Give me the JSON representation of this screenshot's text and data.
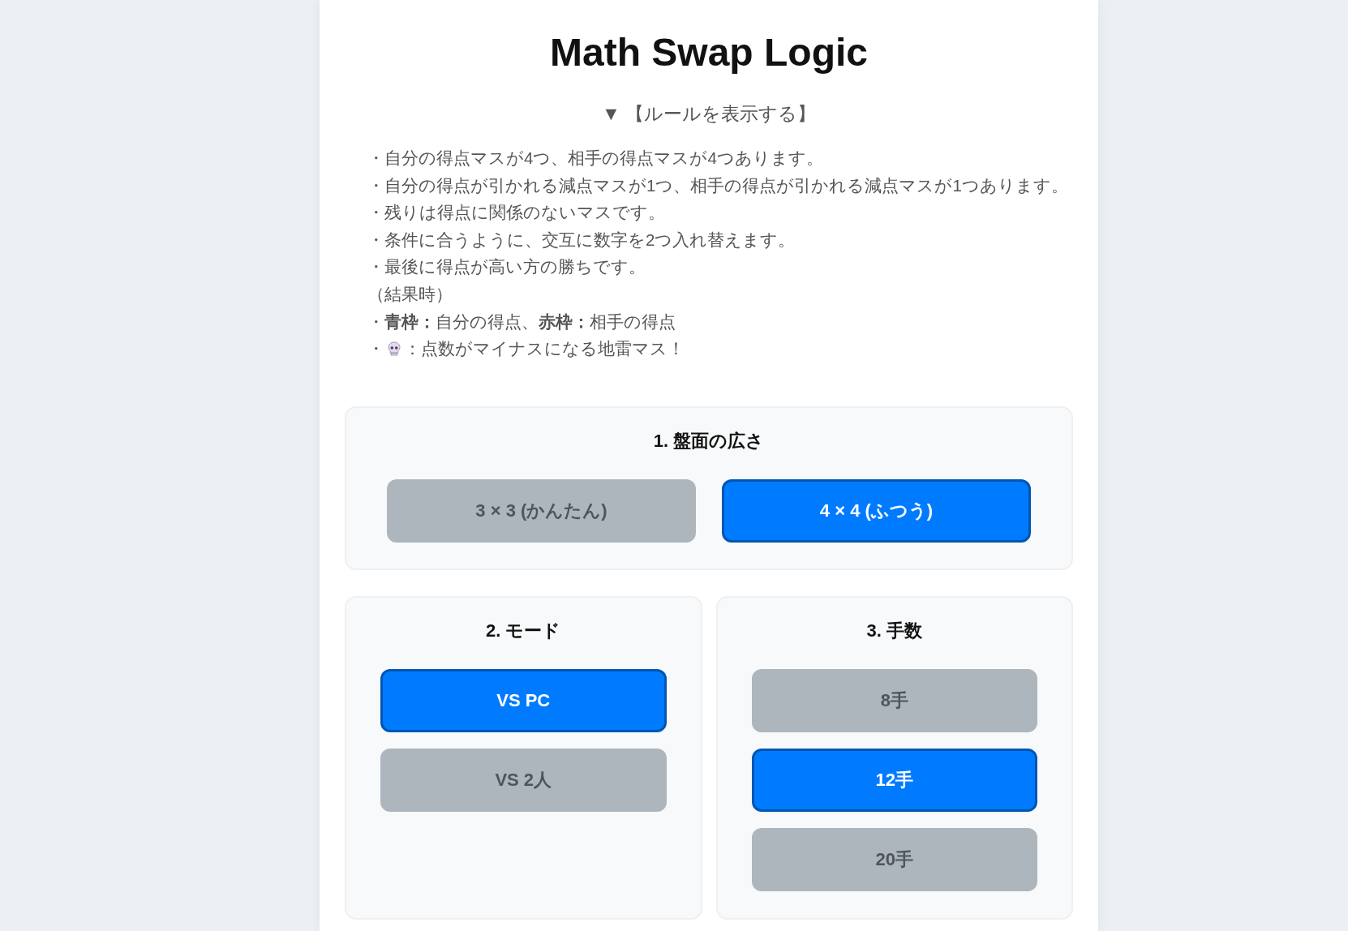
{
  "title": "Math Swap Logic",
  "rules_toggle": {
    "label": "▼ 【ルールを表示する】"
  },
  "rules": [
    {
      "kind": "text",
      "text": "・自分の得点マスが4つ、相手の得点マスが4つあります。"
    },
    {
      "kind": "text",
      "text": "・自分の得点が引かれる減点マスが1つ、相手の得点が引かれる減点マスが1つあります。"
    },
    {
      "kind": "text",
      "text": "・残りは得点に関係のないマスです。"
    },
    {
      "kind": "text",
      "text": "・条件に合うように、交互に数字を2つ入れ替えます。"
    },
    {
      "kind": "text",
      "text": "・最後に得点が高い方の勝ちです。"
    },
    {
      "kind": "text",
      "text": "（結果時）"
    },
    {
      "kind": "text",
      "text": "・**青枠：**自分の得点、**赤枠：**相手の得点"
    },
    {
      "kind": "skull",
      "bullet": "・",
      "text": "：点数がマイナスになる地雷マス！"
    }
  ],
  "board_size": {
    "heading": "1. 盤面の広さ",
    "options": [
      {
        "label": "3 × 3 (かんたん)",
        "selected": false
      },
      {
        "label": "4 × 4 (ふつう)",
        "selected": true
      }
    ]
  },
  "mode": {
    "heading": "2. モード",
    "options": [
      {
        "label": "VS PC",
        "selected": true
      },
      {
        "label": "VS 2人",
        "selected": false
      }
    ]
  },
  "moves": {
    "heading": "3. 手数",
    "options": [
      {
        "label": "8手",
        "selected": false
      },
      {
        "label": "12手",
        "selected": true
      },
      {
        "label": "20手",
        "selected": false
      }
    ]
  }
}
